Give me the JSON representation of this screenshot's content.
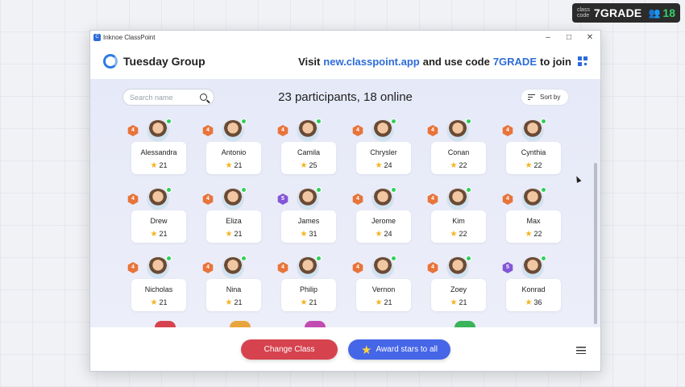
{
  "class_code_badge": {
    "small_label": "class code",
    "code": "7GRADE",
    "people_icon": "people-icon",
    "count": "18"
  },
  "window": {
    "title": "Inknoe ClassPoint",
    "controls": {
      "minimize": "–",
      "maximize": "□",
      "close": "✕"
    }
  },
  "header": {
    "group_name": "Tuesday Group",
    "join_prefix": "Visit",
    "join_url": "new.classpoint.app",
    "join_middle": "and use code",
    "join_code": "7GRADE",
    "join_suffix": "to join",
    "qr_icon": "qr-code-icon"
  },
  "toolbar": {
    "search_placeholder": "Search name",
    "participants_summary": "23 participants, 18 online",
    "sort_label": "Sort by"
  },
  "participants": [
    {
      "name": "Alessandra",
      "stars": "21",
      "level": "4",
      "online": true
    },
    {
      "name": "Antonio",
      "stars": "21",
      "level": "4",
      "online": true
    },
    {
      "name": "Camila",
      "stars": "25",
      "level": "4",
      "online": true
    },
    {
      "name": "Chrysler",
      "stars": "24",
      "level": "4",
      "online": true
    },
    {
      "name": "Conan",
      "stars": "22",
      "level": "4",
      "online": true
    },
    {
      "name": "Cynthia",
      "stars": "22",
      "level": "4",
      "online": true
    },
    {
      "name": "Drew",
      "stars": "21",
      "level": "4",
      "online": true
    },
    {
      "name": "Eliza",
      "stars": "21",
      "level": "4",
      "online": true
    },
    {
      "name": "James",
      "stars": "31",
      "level": "5",
      "online": true
    },
    {
      "name": "Jerome",
      "stars": "24",
      "level": "4",
      "online": true
    },
    {
      "name": "Kim",
      "stars": "22",
      "level": "4",
      "online": true
    },
    {
      "name": "Max",
      "stars": "22",
      "level": "4",
      "online": true
    },
    {
      "name": "Nicholas",
      "stars": "21",
      "level": "4",
      "online": true
    },
    {
      "name": "Nina",
      "stars": "21",
      "level": "4",
      "online": true
    },
    {
      "name": "Philip",
      "stars": "21",
      "level": "4",
      "online": true
    },
    {
      "name": "Vernon",
      "stars": "21",
      "level": "4",
      "online": true
    },
    {
      "name": "Zoey",
      "stars": "21",
      "level": "4",
      "online": true
    },
    {
      "name": "Konrad",
      "stars": "36",
      "level": "5",
      "online": true
    }
  ],
  "footer": {
    "change_class_label": "Change Class",
    "award_label": "Award stars to all",
    "menu_icon": "hamburger-menu-icon"
  },
  "colors": {
    "accent_blue": "#4666e8",
    "change_class_red": "#d6434f",
    "level4_orange": "#e8743b",
    "level5_purple": "#8456d6",
    "online_green": "#2ed158",
    "star_gold": "#f5b31c"
  }
}
